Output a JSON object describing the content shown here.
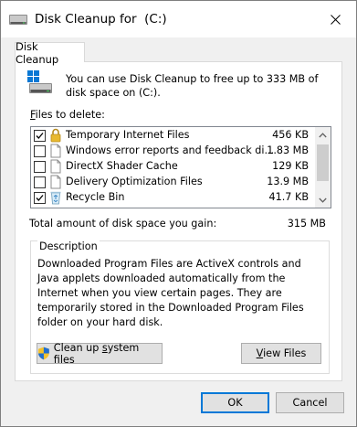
{
  "window": {
    "title": "Disk Cleanup for  (C:)"
  },
  "tab": {
    "label": "Disk Cleanup"
  },
  "intro": {
    "text": "You can use Disk Cleanup to free up to 333 MB of disk space on  (C:)."
  },
  "files_label": {
    "u": "F",
    "rest": "iles to delete:"
  },
  "files": [
    {
      "name": "Temporary Internet Files",
      "size": "456 KB",
      "checked": true,
      "icon": "lock-icon"
    },
    {
      "name": "Windows error reports and feedback di...",
      "size": "1.83 MB",
      "checked": false,
      "icon": "file-icon"
    },
    {
      "name": "DirectX Shader Cache",
      "size": "129 KB",
      "checked": false,
      "icon": "file-icon"
    },
    {
      "name": "Delivery Optimization Files",
      "size": "13.9 MB",
      "checked": false,
      "icon": "file-icon"
    },
    {
      "name": "Recycle Bin",
      "size": "41.7 KB",
      "checked": true,
      "icon": "recycle-bin-icon"
    }
  ],
  "total": {
    "label": "Total amount of disk space you gain:",
    "value": "315 MB"
  },
  "description": {
    "legend": "Description",
    "text": "Downloaded Program Files are ActiveX controls and Java applets downloaded automatically from the Internet when you view certain pages. They are temporarily stored in the Downloaded Program Files folder on your hard disk."
  },
  "buttons": {
    "cleanup_pre": "Clean up ",
    "cleanup_u": "s",
    "cleanup_post": "ystem files",
    "view_u": "V",
    "view_post": "iew Files",
    "ok": "OK",
    "cancel": "Cancel"
  }
}
